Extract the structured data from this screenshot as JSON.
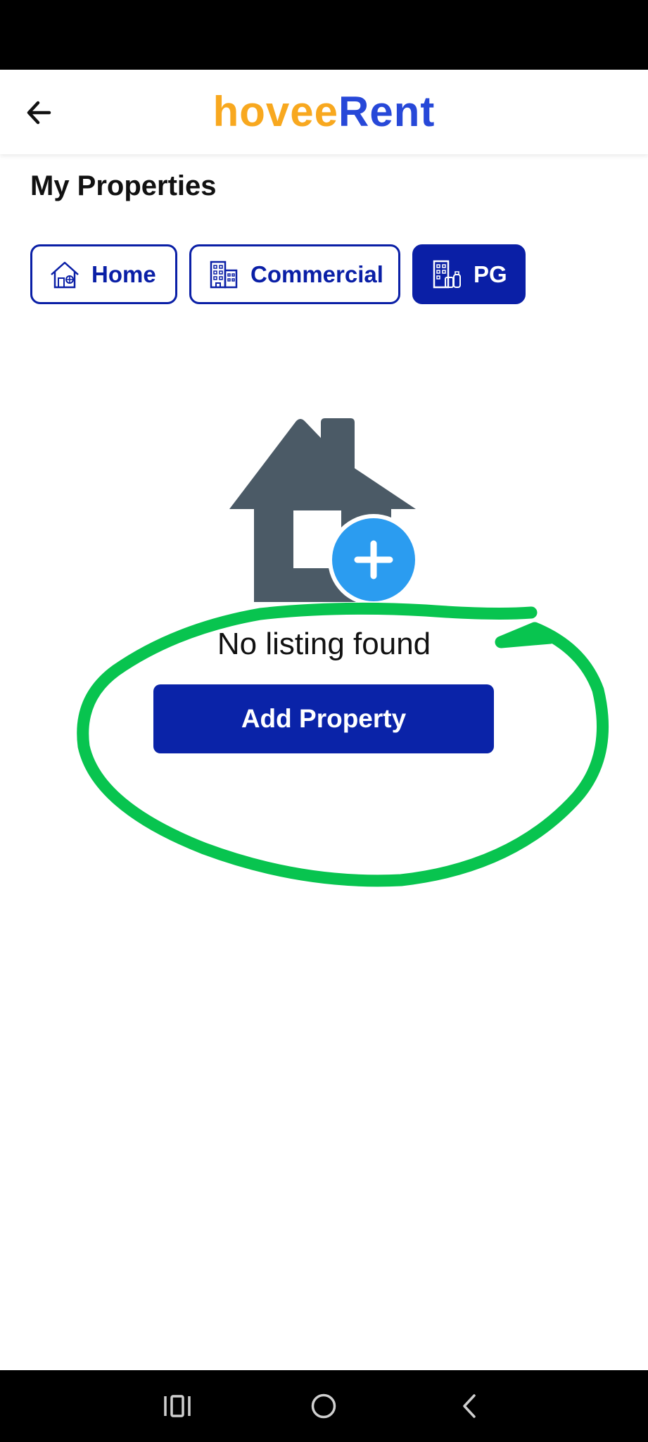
{
  "header": {
    "brand_part1": "hovee",
    "brand_part2": "Rent",
    "back_icon": "arrow-left-icon"
  },
  "page": {
    "title": "My Properties"
  },
  "tabs": [
    {
      "label": "Home",
      "icon": "house-icon",
      "active": false
    },
    {
      "label": "Commercial",
      "icon": "office-building-icon",
      "active": false
    },
    {
      "label": "PG",
      "icon": "pg-building-icon",
      "active": true
    }
  ],
  "empty_state": {
    "icon": "house-add-icon",
    "message": "No listing found",
    "button_label": "Add Property"
  },
  "annotation": {
    "shape": "hand-drawn ellipse",
    "color": "#08c44f"
  },
  "nav_bar": {
    "icons": [
      "recent-apps-icon",
      "home-circle-icon",
      "back-chevron-icon"
    ]
  },
  "colors": {
    "primary": "#0a1fa6",
    "brand_orange": "#f8a81f",
    "brand_blue": "#2748d8",
    "illustration_gray": "#4b5a66",
    "illustration_plus": "#2b9cf0"
  }
}
